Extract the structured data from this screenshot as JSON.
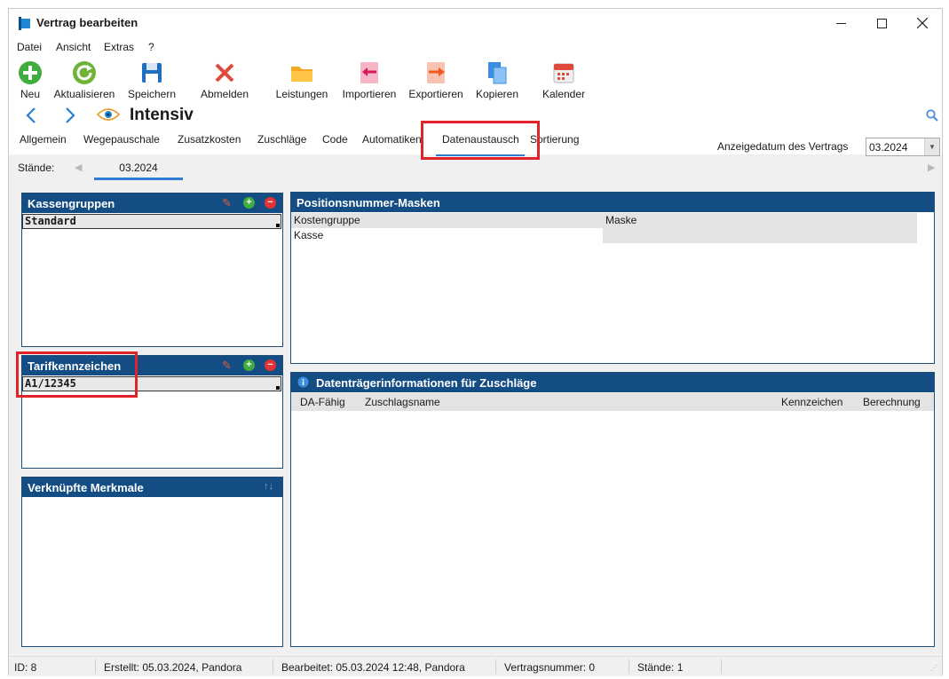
{
  "window": {
    "title": "Vertrag bearbeiten"
  },
  "menu": [
    "Datei",
    "Ansicht",
    "Extras",
    "?"
  ],
  "toolbar": [
    {
      "label": "Neu",
      "icon": "plus-circle-icon"
    },
    {
      "label": "Aktualisieren",
      "icon": "refresh-icon"
    },
    {
      "label": "Speichern",
      "icon": "save-icon"
    },
    {
      "label": "Abmelden",
      "icon": "x-logout-icon"
    },
    {
      "label": "Leistungen",
      "icon": "folder-icon"
    },
    {
      "label": "Importieren",
      "icon": "import-icon"
    },
    {
      "label": "Exportieren",
      "icon": "export-icon"
    },
    {
      "label": "Kopieren",
      "icon": "copy-icon"
    },
    {
      "label": "Kalender",
      "icon": "calendar-icon"
    }
  ],
  "header": {
    "title": "Intensiv"
  },
  "tabs": [
    {
      "label": "Allgemein"
    },
    {
      "label": "Wegepauschale"
    },
    {
      "label": "Zusatzkosten"
    },
    {
      "label": "Zuschläge"
    },
    {
      "label": "Code"
    },
    {
      "label": "Automatiken"
    },
    {
      "label": "Datenaustausch",
      "active": true
    },
    {
      "label": "Sortierung"
    }
  ],
  "date_filter": {
    "label": "Anzeigedatum des Vertrags",
    "value": "03.2024"
  },
  "staende": {
    "label": "Stände:",
    "tabs": [
      "03.2024"
    ]
  },
  "kassengruppen": {
    "title": "Kassengruppen",
    "rows": [
      "Standard"
    ]
  },
  "tarifkennzeichen": {
    "title": "Tarifkennzeichen",
    "rows": [
      "A1/12345"
    ]
  },
  "merkmale": {
    "title": "Verknüpfte Merkmale"
  },
  "positionsnummer": {
    "title": "Positionsnummer-Masken",
    "columns": [
      "Kostengruppe",
      "Maske"
    ],
    "rows": [
      [
        "Kasse",
        ""
      ]
    ]
  },
  "datentraeger": {
    "title": "Datenträgerinformationen für Zuschläge",
    "columns": [
      "DA-Fähig",
      "Zuschlagsname",
      "Kennzeichen",
      "Berechnung"
    ]
  },
  "status": {
    "id": "ID: 8",
    "erstellt": "Erstellt: 05.03.2024, Pandora",
    "bearbeitet": "Bearbeitet: 05.03.2024 12:48, Pandora",
    "vertragsnummer": "Vertragsnummer: 0",
    "staende": "Stände: 1"
  },
  "colors": {
    "panel_header": "#134d84",
    "accent": "#2b7cd3",
    "highlight": "#e0242a"
  }
}
